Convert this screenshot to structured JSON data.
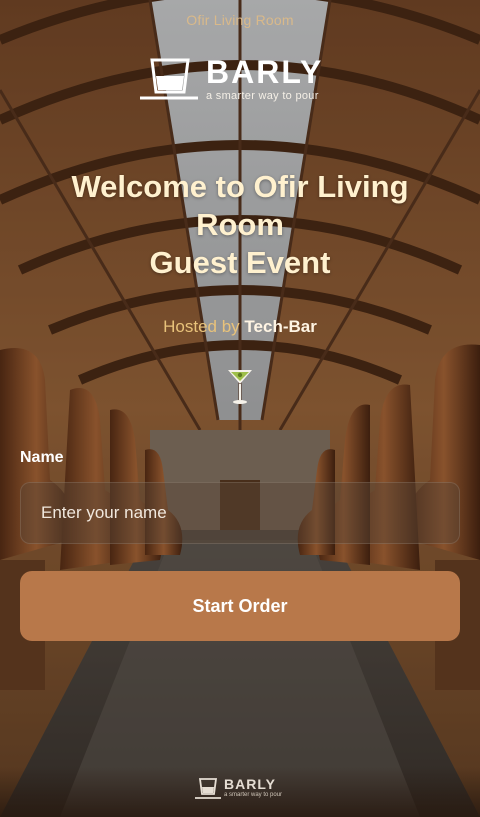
{
  "venue_name": "Ofir Living Room",
  "brand": {
    "wordmark": "BARLY",
    "tagline": "a smarter way to pour"
  },
  "welcome": {
    "line1": "Welcome to Ofir Living",
    "line2": "Room",
    "line3": "Guest Event"
  },
  "hosted": {
    "prefix": "Hosted by",
    "host": "Tech-Bar"
  },
  "form": {
    "name_label": "Name",
    "name_placeholder": "Enter your name",
    "name_value": "",
    "start_label": "Start Order"
  },
  "colors": {
    "accent_button": "#b8784a",
    "title_text": "#fff1cf",
    "hosted_prefix": "#e8c27a",
    "venue_text": "#d9b98a"
  },
  "icons": [
    "glass-logo-icon",
    "cocktail-glass-icon"
  ]
}
